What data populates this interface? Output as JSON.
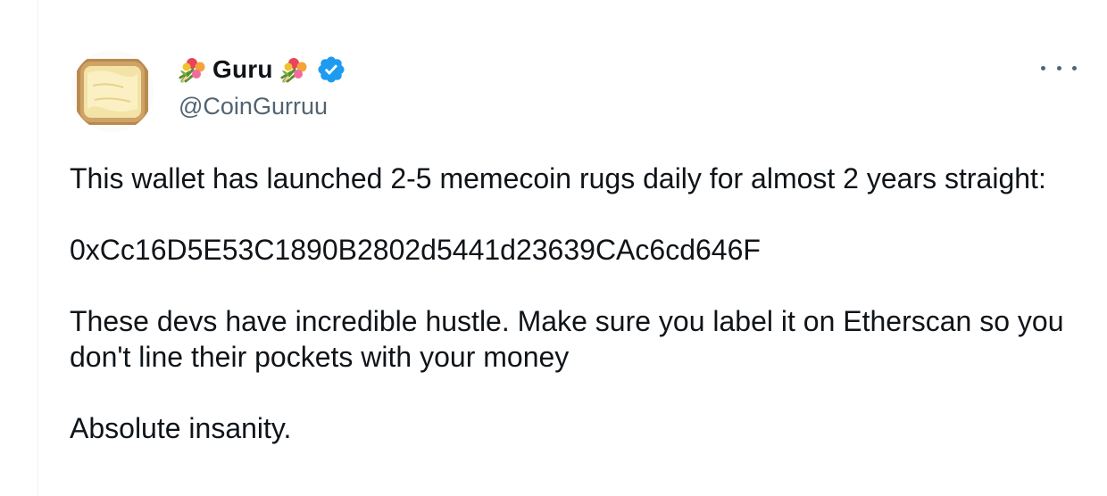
{
  "author": {
    "display_name": "Guru",
    "handle": "@CoinGurruu",
    "verified": true,
    "name_decoration_icon": "flower-bouquet-icon",
    "avatar_icon": "buttered-toast-avatar"
  },
  "menu": {
    "more_icon": "more-horizontal-icon"
  },
  "tweet": {
    "paragraphs": [
      "This wallet has launched 2-5 memecoin rugs daily for almost 2 years straight:",
      "0xCc16D5E53C1890B2802d5441d23639CAc6cd646F",
      "These devs have incredible hustle. Make sure you label it on Etherscan so you don't line their pockets with your money",
      "Absolute insanity."
    ]
  },
  "colors": {
    "text_primary": "#0f1419",
    "text_secondary": "#536471",
    "verified_blue": "#1d9bf0",
    "border": "#eff3f4"
  }
}
